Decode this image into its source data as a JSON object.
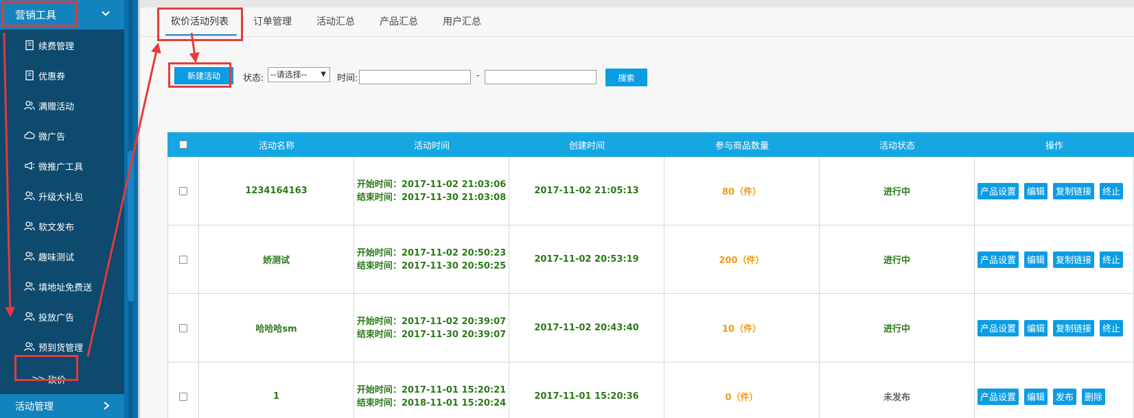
{
  "sidebar": {
    "header_label": "营销工具",
    "items": [
      {
        "label": "续费管理",
        "icon": "document-icon"
      },
      {
        "label": "优惠券",
        "icon": "document-icon"
      },
      {
        "label": "满赠活动",
        "icon": "users-icon"
      },
      {
        "label": "微广告",
        "icon": "cloud-icon"
      },
      {
        "label": "微推广工具",
        "icon": "megaphone-icon"
      },
      {
        "label": "升级大礼包",
        "icon": "users-icon"
      },
      {
        "label": "软文发布",
        "icon": "users-icon"
      },
      {
        "label": "趣味测试",
        "icon": "users-icon"
      },
      {
        "label": "填地址免费送",
        "icon": "users-icon"
      },
      {
        "label": "投放广告",
        "icon": "users-icon"
      },
      {
        "label": "预到货管理",
        "icon": "users-icon"
      }
    ],
    "active_sub_item": {
      "label": "砍价",
      "icon": "double-chevron-icon"
    },
    "footer_label": "活动管理"
  },
  "tabs": [
    "砍价活动列表",
    "订单管理",
    "活动汇总",
    "产品汇总",
    "用户汇总"
  ],
  "toolbar": {
    "new_button": "新建活动",
    "status_label": "状态:",
    "status_value": "--请选择--",
    "time_label": "时间:",
    "time_sep": "-",
    "search_button": "搜索"
  },
  "table": {
    "headers": [
      "活动名称",
      "活动时间",
      "创建时间",
      "参与商品数量",
      "活动状态",
      "操作"
    ],
    "rows": [
      {
        "name": "1234164163",
        "start": "开始时间：2017-11-02 21:03:06",
        "end": "结束时间：2017-11-30 21:03:08",
        "created": "2017-11-02 21:05:13",
        "qty": "80（件）",
        "status": "进行中",
        "ops": [
          "产品设置",
          "编辑",
          "复制链接",
          "终止"
        ]
      },
      {
        "name": "娇测试",
        "start": "开始时间：2017-11-02 20:50:23",
        "end": "结束时间：2017-11-30 20:50:25",
        "created": "2017-11-02 20:53:19",
        "qty": "200（件）",
        "status": "进行中",
        "ops": [
          "产品设置",
          "编辑",
          "复制链接",
          "终止"
        ]
      },
      {
        "name": "哈哈哈sm",
        "start": "开始时间：2017-11-02 20:39:07",
        "end": "结束时间：2017-11-30 20:39:07",
        "created": "2017-11-02 20:43:40",
        "qty": "10（件）",
        "status": "进行中",
        "ops": [
          "产品设置",
          "编辑",
          "复制链接",
          "终止"
        ]
      },
      {
        "name": "1",
        "start": "开始时间：2017-11-01 15:20:21",
        "end": "结束时间：2018-11-01 15:20:24",
        "created": "2017-11-01 15:20:36",
        "qty": "0（件）",
        "status": "未发布",
        "ops": [
          "产品设置",
          "编辑",
          "发布",
          "删除"
        ]
      }
    ]
  },
  "colors": {
    "accent": "#0b9de3",
    "sidebar": "#0d4a6e",
    "annotation": "#e8393a",
    "text_green": "#2a7a17",
    "text_orange": "#f29a12"
  }
}
